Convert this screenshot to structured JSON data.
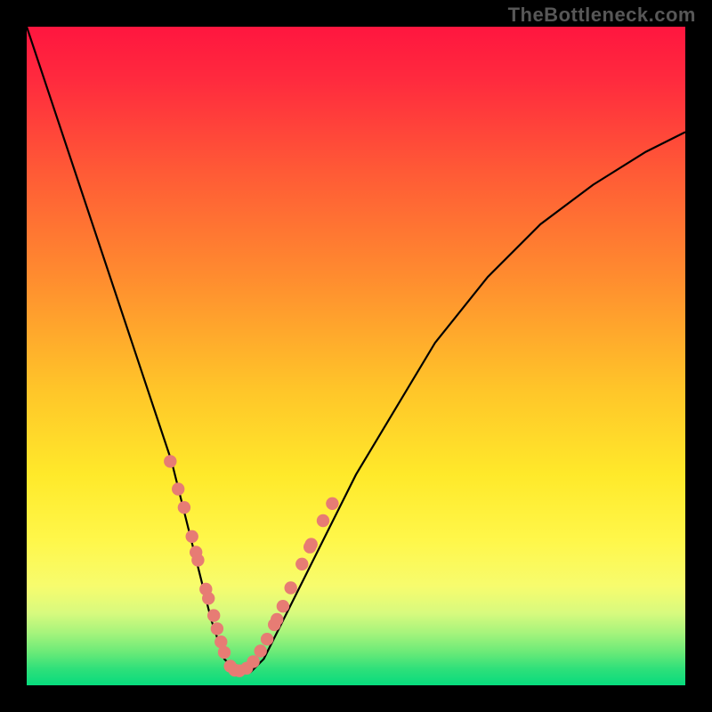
{
  "watermark": "TheBottleneck.com",
  "chart_data": {
    "type": "line",
    "title": "",
    "xlabel": "",
    "ylabel": "",
    "xlim": [
      0,
      100
    ],
    "ylim": [
      0,
      100
    ],
    "series": [
      {
        "name": "bottleneck-curve",
        "x": [
          0,
          4,
          8,
          12,
          16,
          20,
          22,
          24,
          26,
          28,
          30,
          32,
          34,
          36,
          38,
          42,
          46,
          50,
          56,
          62,
          70,
          78,
          86,
          94,
          100
        ],
        "y": [
          100,
          88,
          76,
          64,
          52,
          40,
          34,
          26,
          18,
          10,
          4,
          2,
          2,
          4,
          8,
          16,
          24,
          32,
          42,
          52,
          62,
          70,
          76,
          81,
          84
        ]
      }
    ],
    "markers": {
      "name": "sample-points",
      "color": "#e77c74",
      "points": [
        {
          "x": 21.8,
          "y": 34.0
        },
        {
          "x": 23.0,
          "y": 29.8
        },
        {
          "x": 23.9,
          "y": 27.0
        },
        {
          "x": 25.1,
          "y": 22.6
        },
        {
          "x": 25.7,
          "y": 20.2
        },
        {
          "x": 26.0,
          "y": 19.0
        },
        {
          "x": 27.2,
          "y": 14.6
        },
        {
          "x": 27.6,
          "y": 13.2
        },
        {
          "x": 28.4,
          "y": 10.6
        },
        {
          "x": 28.9,
          "y": 8.6
        },
        {
          "x": 29.5,
          "y": 6.6
        },
        {
          "x": 30.0,
          "y": 5.0
        },
        {
          "x": 30.9,
          "y": 2.9
        },
        {
          "x": 31.6,
          "y": 2.3
        },
        {
          "x": 32.3,
          "y": 2.2
        },
        {
          "x": 33.4,
          "y": 2.6
        },
        {
          "x": 34.4,
          "y": 3.6
        },
        {
          "x": 35.5,
          "y": 5.2
        },
        {
          "x": 36.5,
          "y": 7.0
        },
        {
          "x": 37.6,
          "y": 9.2
        },
        {
          "x": 38.0,
          "y": 10.0
        },
        {
          "x": 38.9,
          "y": 12.0
        },
        {
          "x": 40.1,
          "y": 14.8
        },
        {
          "x": 41.8,
          "y": 18.4
        },
        {
          "x": 43.0,
          "y": 21.0
        },
        {
          "x": 43.2,
          "y": 21.4
        },
        {
          "x": 45.0,
          "y": 25.0
        },
        {
          "x": 46.4,
          "y": 27.6
        }
      ]
    },
    "notes": "A V-shaped curve on a vertical rainbow gradient background (red top → green bottom). The curve minimum (≈0 bottleneck) lies around x≈32. Salmon-colored dot markers cluster along the lower portions of both curve flanks."
  }
}
